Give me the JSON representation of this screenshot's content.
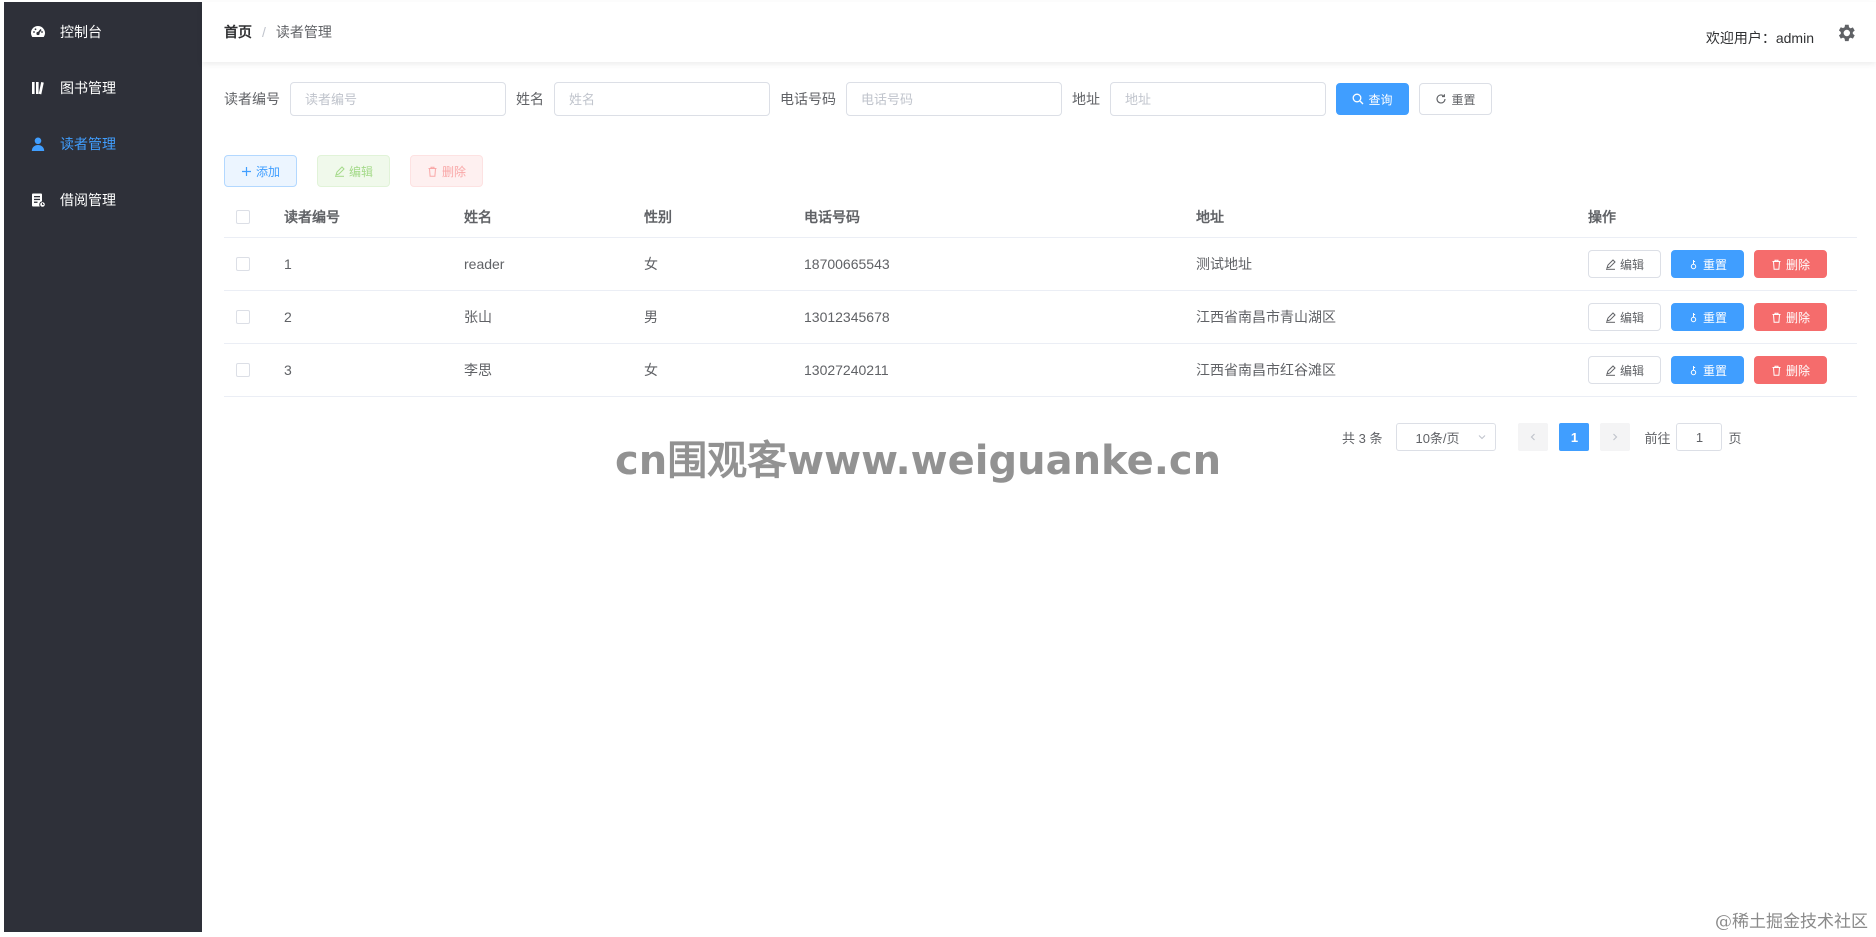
{
  "sidebar": {
    "items": [
      {
        "label": "控制台",
        "icon": "dashboard-icon",
        "active": false
      },
      {
        "label": "图书管理",
        "icon": "books-icon",
        "active": false
      },
      {
        "label": "读者管理",
        "icon": "user-icon",
        "active": true
      },
      {
        "label": "借阅管理",
        "icon": "borrow-document-icon",
        "active": false
      }
    ]
  },
  "header": {
    "breadcrumb_home": "首页",
    "breadcrumb_sep": "/",
    "breadcrumb_current": "读者管理",
    "welcome": "欢迎用户：admin"
  },
  "search": {
    "fields": [
      {
        "label": "读者编号",
        "placeholder": "读者编号"
      },
      {
        "label": "姓名",
        "placeholder": "姓名"
      },
      {
        "label": "电话号码",
        "placeholder": "电话号码"
      },
      {
        "label": "地址",
        "placeholder": "地址"
      }
    ],
    "query_label": "查询",
    "reset_label": "重置"
  },
  "toolbar": {
    "add_label": "添加",
    "edit_label": "编辑",
    "delete_label": "删除"
  },
  "table": {
    "columns": [
      "读者编号",
      "姓名",
      "性别",
      "电话号码",
      "地址",
      "操作"
    ],
    "rows": [
      {
        "id": "1",
        "name": "reader",
        "gender": "女",
        "phone": "18700665543",
        "address": "测试地址"
      },
      {
        "id": "2",
        "name": "张山",
        "gender": "男",
        "phone": "13012345678",
        "address": "江西省南昌市青山湖区"
      },
      {
        "id": "3",
        "name": "李思",
        "gender": "女",
        "phone": "13027240211",
        "address": "江西省南昌市红谷滩区"
      }
    ],
    "row_actions": {
      "edit": "编辑",
      "reset": "重置",
      "delete": "删除"
    }
  },
  "pagination": {
    "total_text": "共 3 条",
    "page_size": "10条/页",
    "current_page": "1",
    "goto_prefix": "前往",
    "goto_value": "1",
    "goto_suffix": "页"
  },
  "watermarks": {
    "center": "cn围观客www.weiguanke.cn",
    "corner": "@稀土掘金技术社区"
  },
  "colors": {
    "sidebar_bg": "#2e3039",
    "primary": "#409eff",
    "danger": "#f56c6c"
  }
}
